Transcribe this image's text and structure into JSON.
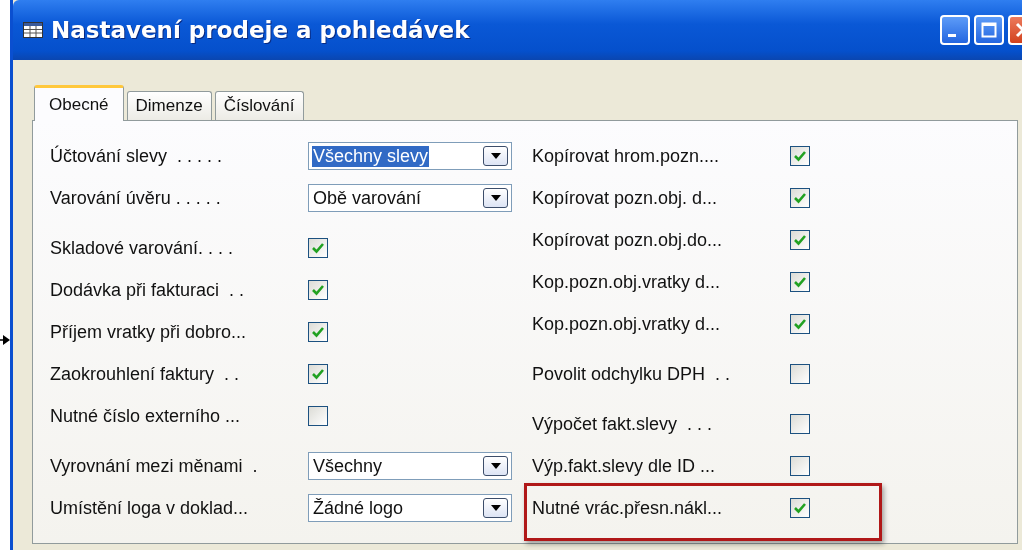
{
  "window": {
    "title": "Nastavení prodeje a pohledávek"
  },
  "tabs": [
    {
      "label": "Obecné",
      "selected": true
    },
    {
      "label": "Dimenze",
      "selected": false
    },
    {
      "label": "Číslování",
      "selected": false
    }
  ],
  "left_column": {
    "groups": [
      [
        {
          "kind": "dropdown",
          "label": "Účtování slevy  . . . . .",
          "value": "Všechny slevy",
          "focused": true
        },
        {
          "kind": "dropdown",
          "label": "Varování úvěru . . . . .",
          "value": "Obě varování",
          "focused": false
        }
      ],
      [
        {
          "kind": "checkbox",
          "label": "Skladové varování. . . .",
          "checked": true
        },
        {
          "kind": "checkbox",
          "label": "Dodávka při fakturaci  . .",
          "checked": true
        },
        {
          "kind": "checkbox",
          "label": "Příjem vratky při dobro...",
          "checked": true
        },
        {
          "kind": "checkbox",
          "label": "Zaokrouhlení faktury  . .",
          "checked": true
        },
        {
          "kind": "checkbox",
          "label": "Nutné číslo externího ...",
          "checked": false
        }
      ],
      [
        {
          "kind": "dropdown",
          "label": "Vyrovnání mezi měnami  .",
          "value": "Všechny",
          "focused": false
        },
        {
          "kind": "dropdown",
          "label": "Umístění loga v doklad...",
          "value": "Žádné logo",
          "focused": false
        }
      ]
    ]
  },
  "right_column": {
    "groups": [
      [
        {
          "kind": "checkbox",
          "label": "Kopírovat hrom.pozn....",
          "checked": true,
          "highlighted": false
        },
        {
          "kind": "checkbox",
          "label": "Kopírovat pozn.obj. d...",
          "checked": true,
          "highlighted": false
        },
        {
          "kind": "checkbox",
          "label": "Kopírovat pozn.obj.do...",
          "checked": true,
          "highlighted": false
        },
        {
          "kind": "checkbox",
          "label": "Kop.pozn.obj.vratky d...",
          "checked": true,
          "highlighted": false
        },
        {
          "kind": "checkbox",
          "label": "Kop.pozn.obj.vratky d...",
          "checked": true,
          "highlighted": false
        }
      ],
      [
        {
          "kind": "checkbox",
          "label": "Povolit odchylku DPH  . .",
          "checked": false,
          "highlighted": false
        }
      ],
      [
        {
          "kind": "checkbox",
          "label": "Výpočet fakt.slevy  . . .",
          "checked": false,
          "highlighted": false
        },
        {
          "kind": "checkbox",
          "label": "Výp.fakt.slevy dle ID ...",
          "checked": false,
          "highlighted": false
        },
        {
          "kind": "checkbox",
          "label": "Nutné vrác.přesn.nákl...",
          "checked": true,
          "highlighted": true
        }
      ]
    ]
  }
}
